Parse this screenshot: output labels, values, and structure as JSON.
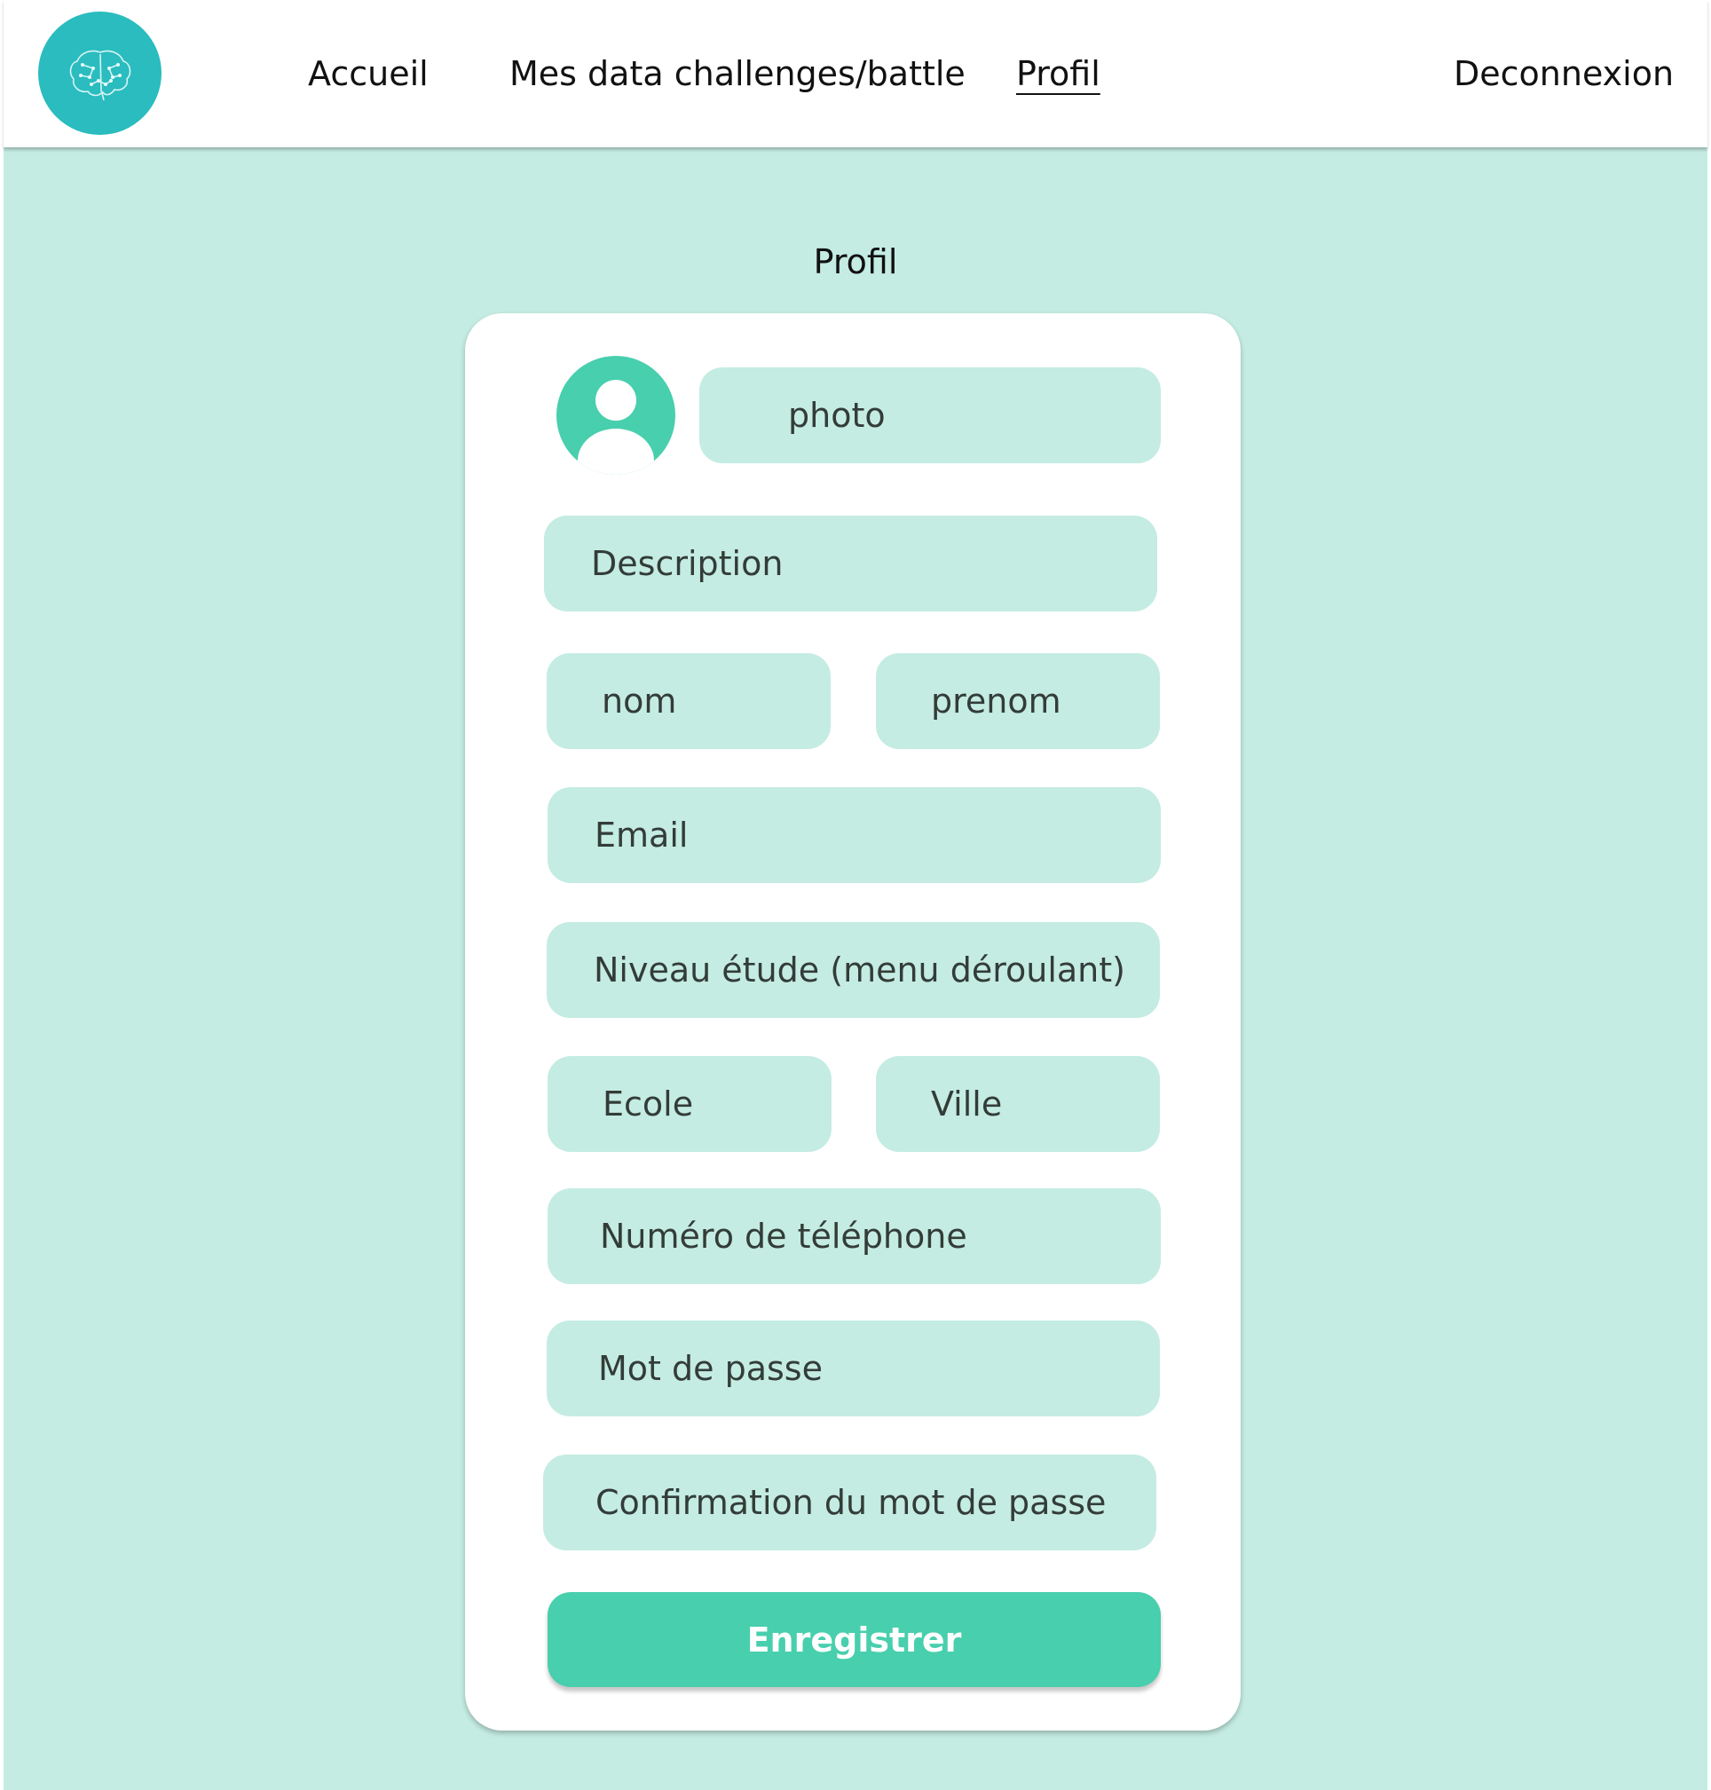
{
  "nav": {
    "logo_icon": "brain-icon",
    "home": "Accueil",
    "challenges": "Mes data challenges/battle",
    "profile": "Profil",
    "logout": "Deconnexion"
  },
  "page": {
    "title": "Profil"
  },
  "form": {
    "avatar_icon": "user-avatar-icon",
    "photo": "photo",
    "description": "Description",
    "nom": "nom",
    "prenom": "prenom",
    "email": "Email",
    "niveau_etude": "Niveau étude (menu déroulant)",
    "ecole": "Ecole",
    "ville": "Ville",
    "telephone": "Numéro de téléphone",
    "mot_de_passe": "Mot de passe",
    "confirmation": "Confirmation du mot de passe",
    "save": "Enregistrer"
  },
  "colors": {
    "background": "#c4ece2",
    "logo": "#2abcbf",
    "accent": "#48cfad",
    "field": "#c4ece2"
  }
}
